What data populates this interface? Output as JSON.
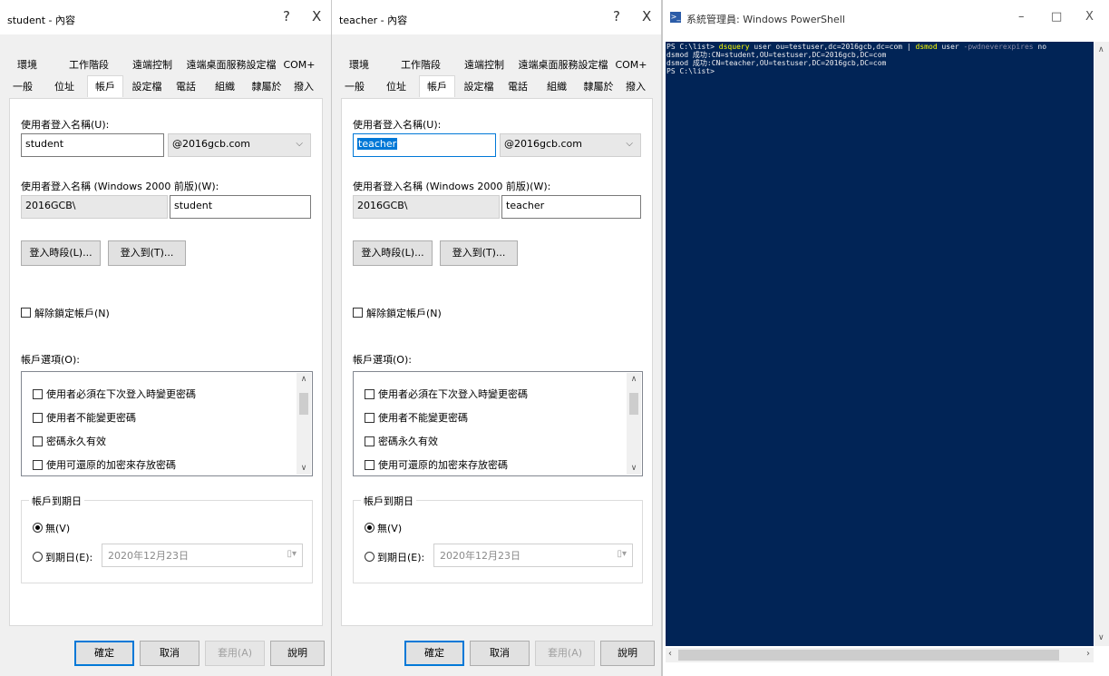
{
  "left_dialog": {
    "title": "student - 內容",
    "help": "?",
    "close": "X",
    "tabs_row1": [
      "環境",
      "工作階段",
      "遠端控制",
      "遠端桌面服務設定檔",
      "COM+"
    ],
    "tabs_row2": [
      "一般",
      "位址",
      "帳戶",
      "設定檔",
      "電話",
      "組織",
      "隸屬於",
      "撥入"
    ],
    "active_tab": "帳戶",
    "logon_name_label": "使用者登入名稱(U):",
    "logon_name_value": "student",
    "domain_value": "@2016gcb.com",
    "pre2000_label": "使用者登入名稱 (Windows 2000 前版)(W):",
    "pre2000_domain": "2016GCB\\",
    "pre2000_user": "student",
    "logon_hours_button": "登入時段(L)...",
    "logon_to_button": "登入到(T)...",
    "unlock_label": "解除鎖定帳戶(N)",
    "account_options_label": "帳戶選項(O):",
    "options": [
      "使用者必須在下次登入時變更密碼",
      "使用者不能變更密碼",
      "密碼永久有效",
      "使用可還原的加密來存放密碼"
    ],
    "expires_group": "帳戶到期日",
    "never_label": "無(V)",
    "end_of_label": "到期日(E):",
    "date_value": "2020年12月23日",
    "ok": "確定",
    "cancel": "取消",
    "apply": "套用(A)",
    "help_button": "說明"
  },
  "right_dialog": {
    "title": "teacher - 內容",
    "help": "?",
    "close": "X",
    "tabs_row1": [
      "環境",
      "工作階段",
      "遠端控制",
      "遠端桌面服務設定檔",
      "COM+"
    ],
    "tabs_row2": [
      "一般",
      "位址",
      "帳戶",
      "設定檔",
      "電話",
      "組織",
      "隸屬於",
      "撥入"
    ],
    "active_tab": "帳戶",
    "logon_name_label": "使用者登入名稱(U):",
    "logon_name_value": "teacher",
    "domain_value": "@2016gcb.com",
    "pre2000_label": "使用者登入名稱 (Windows 2000 前版)(W):",
    "pre2000_domain": "2016GCB\\",
    "pre2000_user": "teacher",
    "logon_hours_button": "登入時段(L)...",
    "logon_to_button": "登入到(T)...",
    "unlock_label": "解除鎖定帳戶(N)",
    "account_options_label": "帳戶選項(O):",
    "options": [
      "使用者必須在下次登入時變更密碼",
      "使用者不能變更密碼",
      "密碼永久有效",
      "使用可還原的加密來存放密碼"
    ],
    "expires_group": "帳戶到期日",
    "never_label": "無(V)",
    "end_of_label": "到期日(E):",
    "date_value": "2020年12月23日",
    "ok": "確定",
    "cancel": "取消",
    "apply": "套用(A)",
    "help_button": "說明"
  },
  "powershell": {
    "title": "系統管理員: Windows PowerShell",
    "minimize": "–",
    "maximize": "□",
    "close": "X",
    "line1": {
      "prompt": "PS C:\\list> ",
      "cmd1": "dsquery",
      "args1": " user ou=testuser,dc=2016gcb,dc=com | ",
      "cmd2": "dsmod",
      "args2": " user ",
      "param": "-pwdneverexpires",
      "val": " no"
    },
    "line2": "dsmod 成功:CN=student,OU=testuser,DC=2016gcb,DC=com",
    "line3": "dsmod 成功:CN=teacher,OU=testuser,DC=2016gcb,DC=com",
    "line4": "PS C:\\list>",
    "colors": {
      "background": "#012456",
      "command": "#ffff00",
      "parameter": "#8a8aa8",
      "text": "#eeedf0"
    }
  }
}
